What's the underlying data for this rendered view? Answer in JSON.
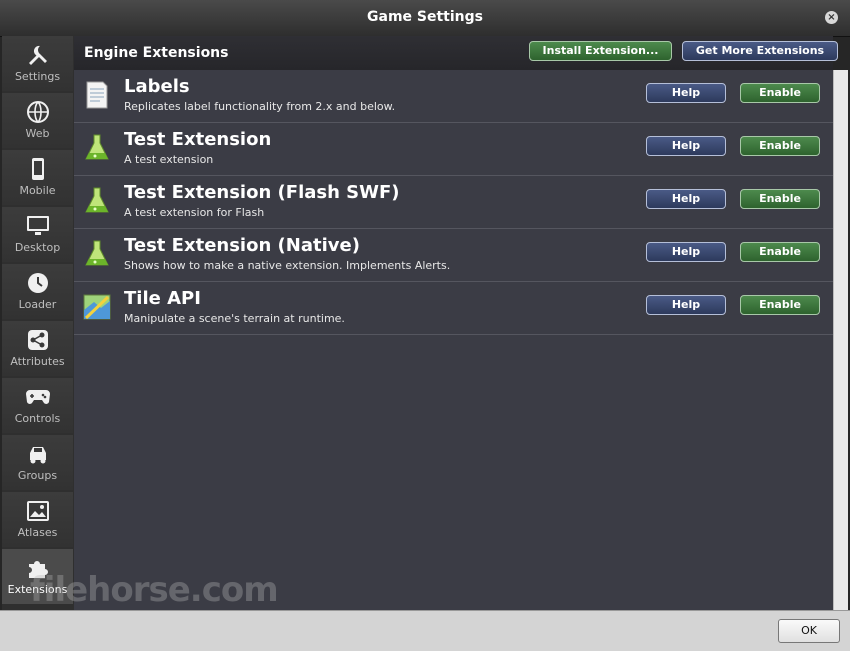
{
  "window": {
    "title": "Game Settings"
  },
  "sidebar": {
    "items": [
      {
        "label": "Settings",
        "icon": "wrench-icon"
      },
      {
        "label": "Web",
        "icon": "globe-icon"
      },
      {
        "label": "Mobile",
        "icon": "phone-icon"
      },
      {
        "label": "Desktop",
        "icon": "monitor-icon"
      },
      {
        "label": "Loader",
        "icon": "clock-icon"
      },
      {
        "label": "Attributes",
        "icon": "share-icon"
      },
      {
        "label": "Controls",
        "icon": "gamepad-icon"
      },
      {
        "label": "Groups",
        "icon": "car-icon"
      },
      {
        "label": "Atlases",
        "icon": "image-icon"
      },
      {
        "label": "Extensions",
        "icon": "puzzle-icon",
        "active": true
      }
    ]
  },
  "main": {
    "title": "Engine Extensions",
    "install_label": "Install Extension...",
    "more_label": "Get More Extensions",
    "extensions": [
      {
        "title": "Labels",
        "desc": "Replicates label functionality from 2.x and below.",
        "icon": "document-icon",
        "help": "Help",
        "enable": "Enable"
      },
      {
        "title": "Test Extension",
        "desc": "A test extension",
        "icon": "flask-icon",
        "help": "Help",
        "enable": "Enable"
      },
      {
        "title": "Test Extension (Flash SWF)",
        "desc": "A test extension for Flash",
        "icon": "flask-icon",
        "help": "Help",
        "enable": "Enable"
      },
      {
        "title": "Test Extension (Native)",
        "desc": "Shows how to make a native extension. Implements Alerts.",
        "icon": "flask-icon",
        "help": "Help",
        "enable": "Enable"
      },
      {
        "title": "Tile API",
        "desc": "Manipulate a scene's terrain at runtime.",
        "icon": "map-icon",
        "help": "Help",
        "enable": "Enable"
      }
    ]
  },
  "footer": {
    "ok_label": "OK"
  },
  "watermark": "filehorse.com",
  "colors": {
    "accent_green": "#2e632e",
    "accent_navy": "#2d3a5c",
    "panel": "#3b3c45"
  }
}
